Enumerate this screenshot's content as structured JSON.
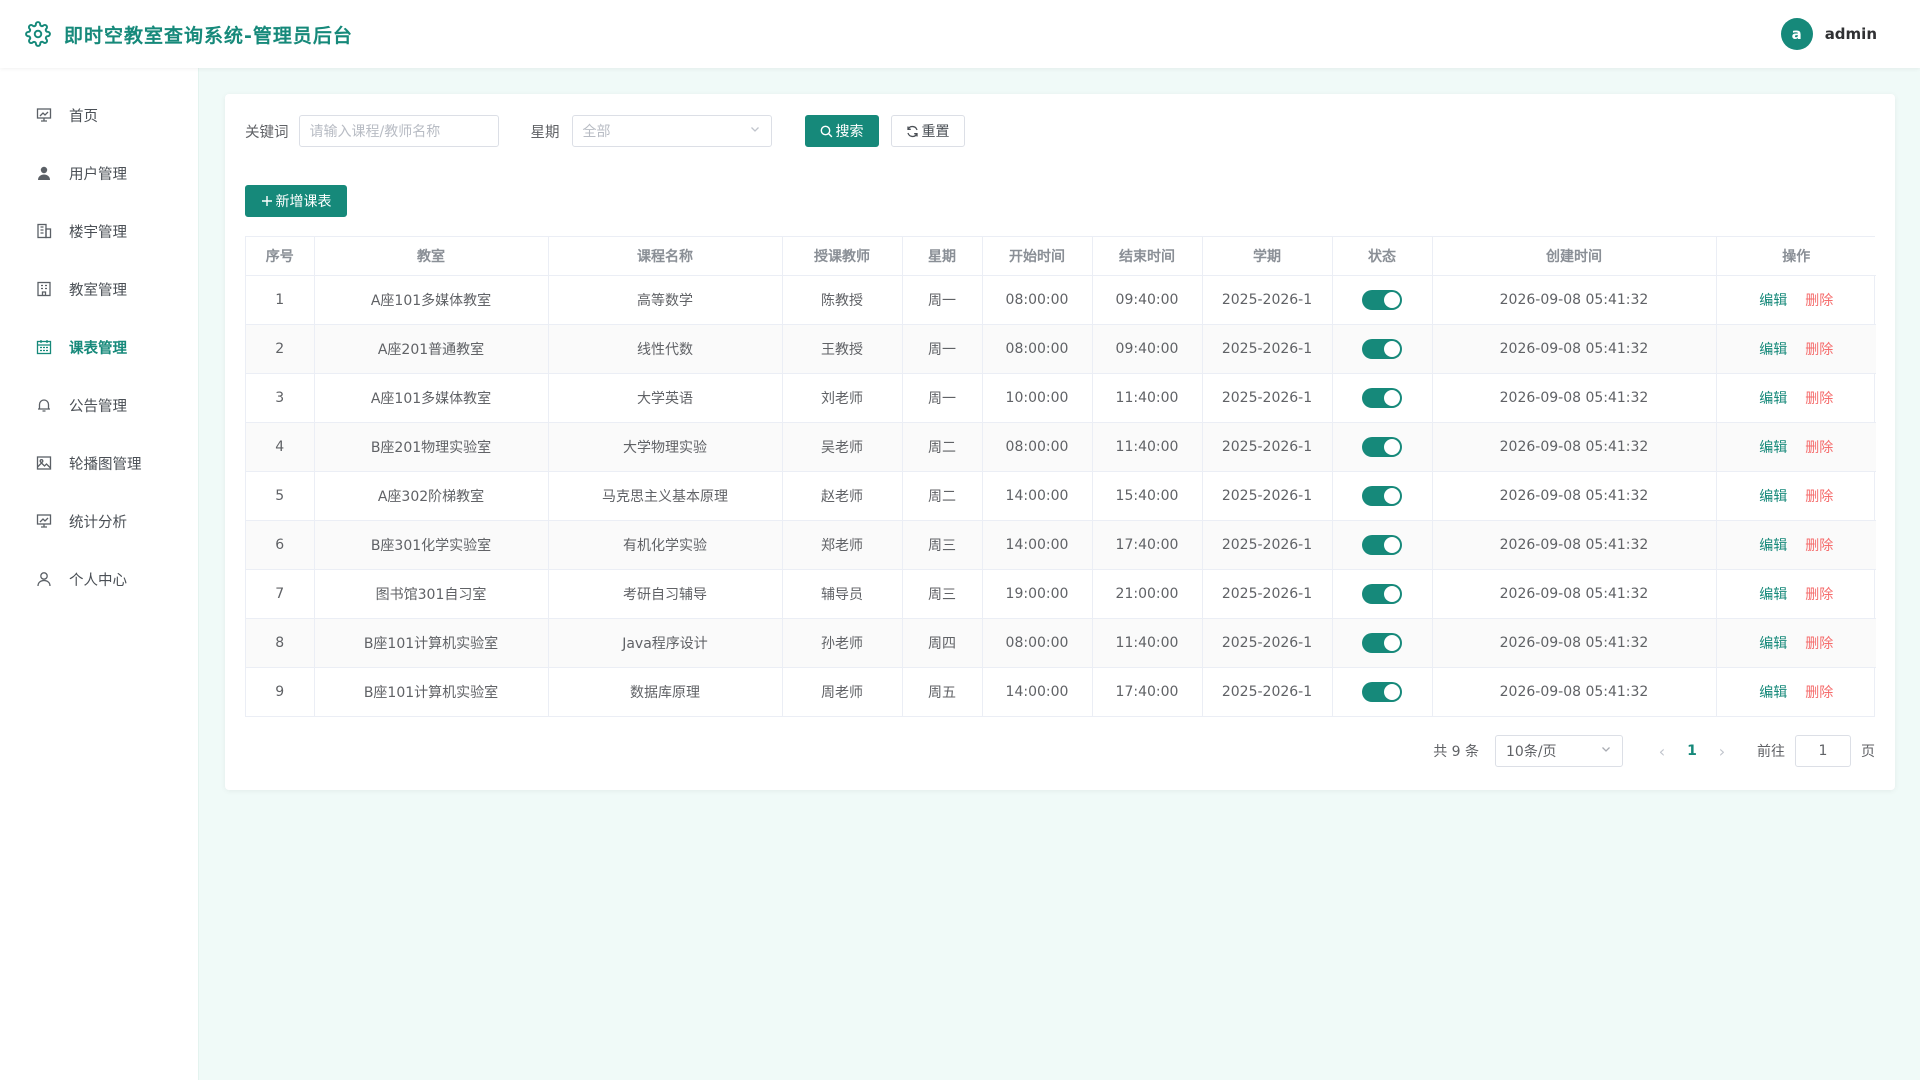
{
  "header": {
    "title": "即时空教室查询系统-管理员后台",
    "user": {
      "avatar_letter": "a",
      "name": "admin"
    }
  },
  "sidebar": {
    "items": [
      {
        "label": "首页",
        "icon": "home-screen-icon"
      },
      {
        "label": "用户管理",
        "icon": "user-icon"
      },
      {
        "label": "楼宇管理",
        "icon": "building-icon"
      },
      {
        "label": "教室管理",
        "icon": "classroom-icon"
      },
      {
        "label": "课表管理",
        "icon": "calendar-icon",
        "active": true
      },
      {
        "label": "公告管理",
        "icon": "bell-icon"
      },
      {
        "label": "轮播图管理",
        "icon": "image-icon"
      },
      {
        "label": "统计分析",
        "icon": "chart-screen-icon"
      },
      {
        "label": "个人中心",
        "icon": "person-icon"
      }
    ]
  },
  "filters": {
    "keyword_label": "关键词",
    "keyword_placeholder": "请输入课程/教师名称",
    "week_label": "星期",
    "week_value": "全部",
    "search_label": "搜索",
    "reset_label": "重置"
  },
  "add_button_label": "新增课表",
  "table": {
    "columns": [
      "序号",
      "教室",
      "课程名称",
      "授课教师",
      "星期",
      "开始时间",
      "结束时间",
      "学期",
      "状态",
      "创建时间",
      "操作"
    ],
    "rows": [
      {
        "no": "1",
        "room": "A座101多媒体教室",
        "course": "高等数学",
        "teacher": "陈教授",
        "week": "周一",
        "start": "08:00:00",
        "end": "09:40:00",
        "term": "2025-2026-1",
        "status": true,
        "created": "2026-09-08 05:41:32"
      },
      {
        "no": "2",
        "room": "A座201普通教室",
        "course": "线性代数",
        "teacher": "王教授",
        "week": "周一",
        "start": "08:00:00",
        "end": "09:40:00",
        "term": "2025-2026-1",
        "status": true,
        "created": "2026-09-08 05:41:32"
      },
      {
        "no": "3",
        "room": "A座101多媒体教室",
        "course": "大学英语",
        "teacher": "刘老师",
        "week": "周一",
        "start": "10:00:00",
        "end": "11:40:00",
        "term": "2025-2026-1",
        "status": true,
        "created": "2026-09-08 05:41:32"
      },
      {
        "no": "4",
        "room": "B座201物理实验室",
        "course": "大学物理实验",
        "teacher": "吴老师",
        "week": "周二",
        "start": "08:00:00",
        "end": "11:40:00",
        "term": "2025-2026-1",
        "status": true,
        "created": "2026-09-08 05:41:32"
      },
      {
        "no": "5",
        "room": "A座302阶梯教室",
        "course": "马克思主义基本原理",
        "teacher": "赵老师",
        "week": "周二",
        "start": "14:00:00",
        "end": "15:40:00",
        "term": "2025-2026-1",
        "status": true,
        "created": "2026-09-08 05:41:32"
      },
      {
        "no": "6",
        "room": "B座301化学实验室",
        "course": "有机化学实验",
        "teacher": "郑老师",
        "week": "周三",
        "start": "14:00:00",
        "end": "17:40:00",
        "term": "2025-2026-1",
        "status": true,
        "created": "2026-09-08 05:41:32"
      },
      {
        "no": "7",
        "room": "图书馆301自习室",
        "course": "考研自习辅导",
        "teacher": "辅导员",
        "week": "周三",
        "start": "19:00:00",
        "end": "21:00:00",
        "term": "2025-2026-1",
        "status": true,
        "created": "2026-09-08 05:41:32"
      },
      {
        "no": "8",
        "room": "B座101计算机实验室",
        "course": "Java程序设计",
        "teacher": "孙老师",
        "week": "周四",
        "start": "08:00:00",
        "end": "11:40:00",
        "term": "2025-2026-1",
        "status": true,
        "created": "2026-09-08 05:41:32"
      },
      {
        "no": "9",
        "room": "B座101计算机实验室",
        "course": "数据库原理",
        "teacher": "周老师",
        "week": "周五",
        "start": "14:00:00",
        "end": "17:40:00",
        "term": "2025-2026-1",
        "status": true,
        "created": "2026-09-08 05:41:32"
      }
    ],
    "edit_label": "编辑",
    "delete_label": "删除"
  },
  "pagination": {
    "total_text": "共 9 条",
    "page_size": "10条/页",
    "current_page": "1",
    "goto_label": "前往",
    "goto_value": "1",
    "page_suffix": "页"
  },
  "colors": {
    "primary": "#16897a",
    "danger": "#f56c6c",
    "background": "#f0faf8"
  }
}
